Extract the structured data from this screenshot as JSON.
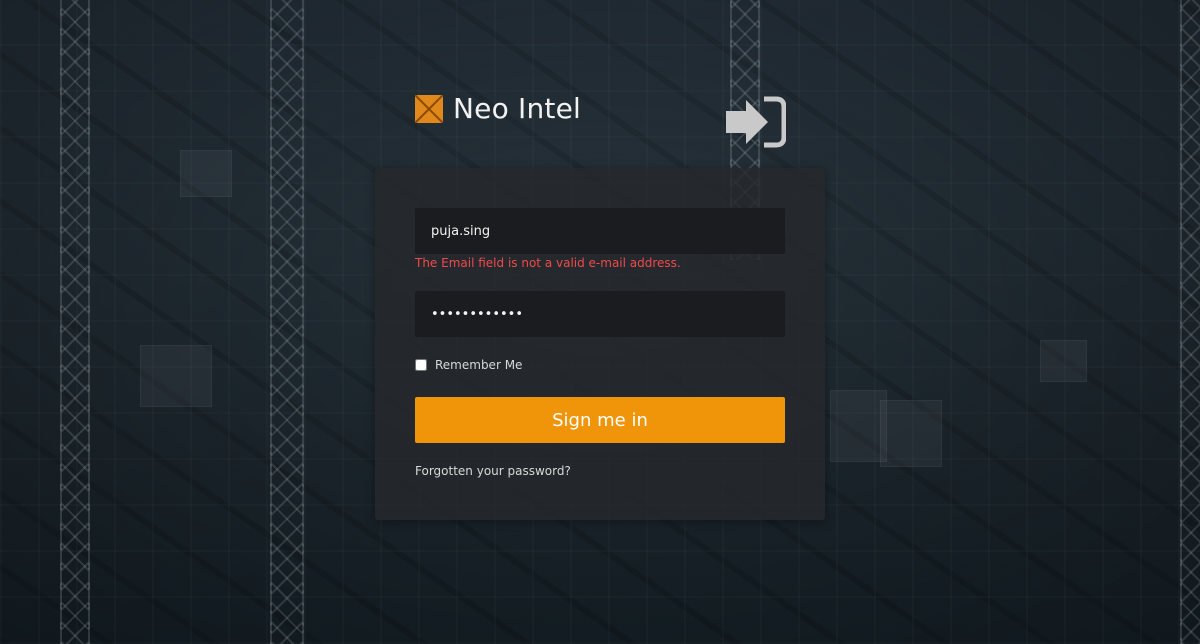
{
  "brand": {
    "name": "Neo Intel",
    "logo_color": "#e0891a"
  },
  "login_icon": "sign-in-icon",
  "form": {
    "email": {
      "value": "puja.sing",
      "placeholder": "Email"
    },
    "email_error": "The Email field is not a valid e-mail address.",
    "password": {
      "value": "••••••••••••",
      "placeholder": "Password"
    },
    "remember_label": "Remember Me",
    "remember_checked": false,
    "signin_label": "Sign me in",
    "forgot_label": "Forgotten your password?"
  },
  "colors": {
    "accent": "#f0940a",
    "error": "#ef4a4a"
  }
}
